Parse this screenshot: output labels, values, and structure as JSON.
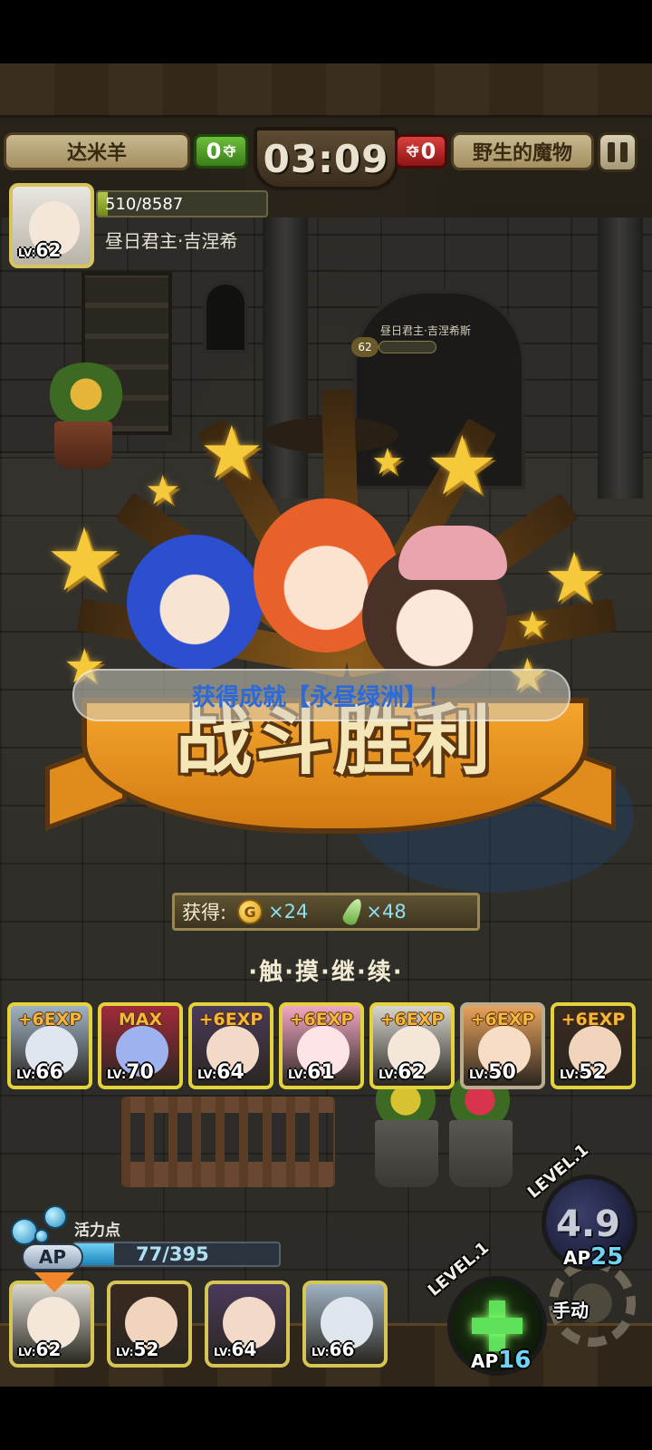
{
  "hud": {
    "player_name": "达米羊",
    "player_score": "0",
    "player_score_unit": "夺",
    "timer": "03:09",
    "enemy_score": "0",
    "enemy_score_unit": "夺",
    "enemy_name": "野生的魔物"
  },
  "hero_status": {
    "level_prefix": "LV:",
    "level": "62",
    "hp_text": "510/8587",
    "hp_fraction": 0.06,
    "name": "昼日君主·吉涅希"
  },
  "enemy_marker": {
    "name": "昼日君主·吉涅希斯",
    "level": "62"
  },
  "victory": {
    "title": "战斗胜利",
    "achievement": "获得成就【永昼绿洲】！"
  },
  "rewards": {
    "label": "获得:",
    "coin_symbol": "G",
    "coin_amount": "×24",
    "feather_amount": "×48"
  },
  "touch_continue": "·触·摸·继·续·",
  "party": [
    {
      "badge": "+6EXP",
      "lv_prefix": "LV:",
      "level": "66",
      "color": "#9fb2c2",
      "face": "#dfe6ee"
    },
    {
      "badge": "MAX",
      "lv_prefix": "LV:",
      "level": "70",
      "color": "#a02a3a",
      "face": "#9fb2f0"
    },
    {
      "badge": "+6EXP",
      "lv_prefix": "LV:",
      "level": "64",
      "color": "#4a3a5a",
      "face": "#f2d9c8"
    },
    {
      "badge": "+6EXP",
      "lv_prefix": "LV:",
      "level": "61",
      "color": "#f2a7c3",
      "face": "#fbe3e6"
    },
    {
      "badge": "+6EXP",
      "lv_prefix": "LV:",
      "level": "62",
      "color": "#d9d6cf",
      "face": "#f4e6d9"
    },
    {
      "badge": "+6EXP",
      "lv_prefix": "LV:",
      "level": "50",
      "color": "#e9a25c",
      "face": "#f7dcc6"
    },
    {
      "badge": "+6EXP",
      "lv_prefix": "LV:",
      "level": "52",
      "color": "#3a2a20",
      "face": "#f0d4bc"
    }
  ],
  "ap": {
    "label": "AP",
    "title": "活力点",
    "text": "77/395",
    "fraction": 0.195
  },
  "bottom_heroes": [
    {
      "lv_prefix": "LV:",
      "level": "62",
      "color": "#d9d6cf",
      "face": "#f4e6d9"
    },
    {
      "lv_prefix": "LV:",
      "level": "52",
      "color": "#3a2a20",
      "face": "#f0d4bc"
    },
    {
      "lv_prefix": "LV:",
      "level": "64",
      "color": "#4a3a5a",
      "face": "#f2d9c8"
    },
    {
      "lv_prefix": "LV:",
      "level": "66",
      "color": "#9fb2c2",
      "face": "#dfe6ee"
    }
  ],
  "skills": {
    "dark": {
      "level": "LEVEL.1",
      "value": "4.9",
      "ap_label": "AP",
      "ap_cost": "25"
    },
    "green": {
      "level": "LEVEL.1",
      "ap_label": "AP",
      "ap_cost": "16"
    },
    "manual": "手动"
  }
}
